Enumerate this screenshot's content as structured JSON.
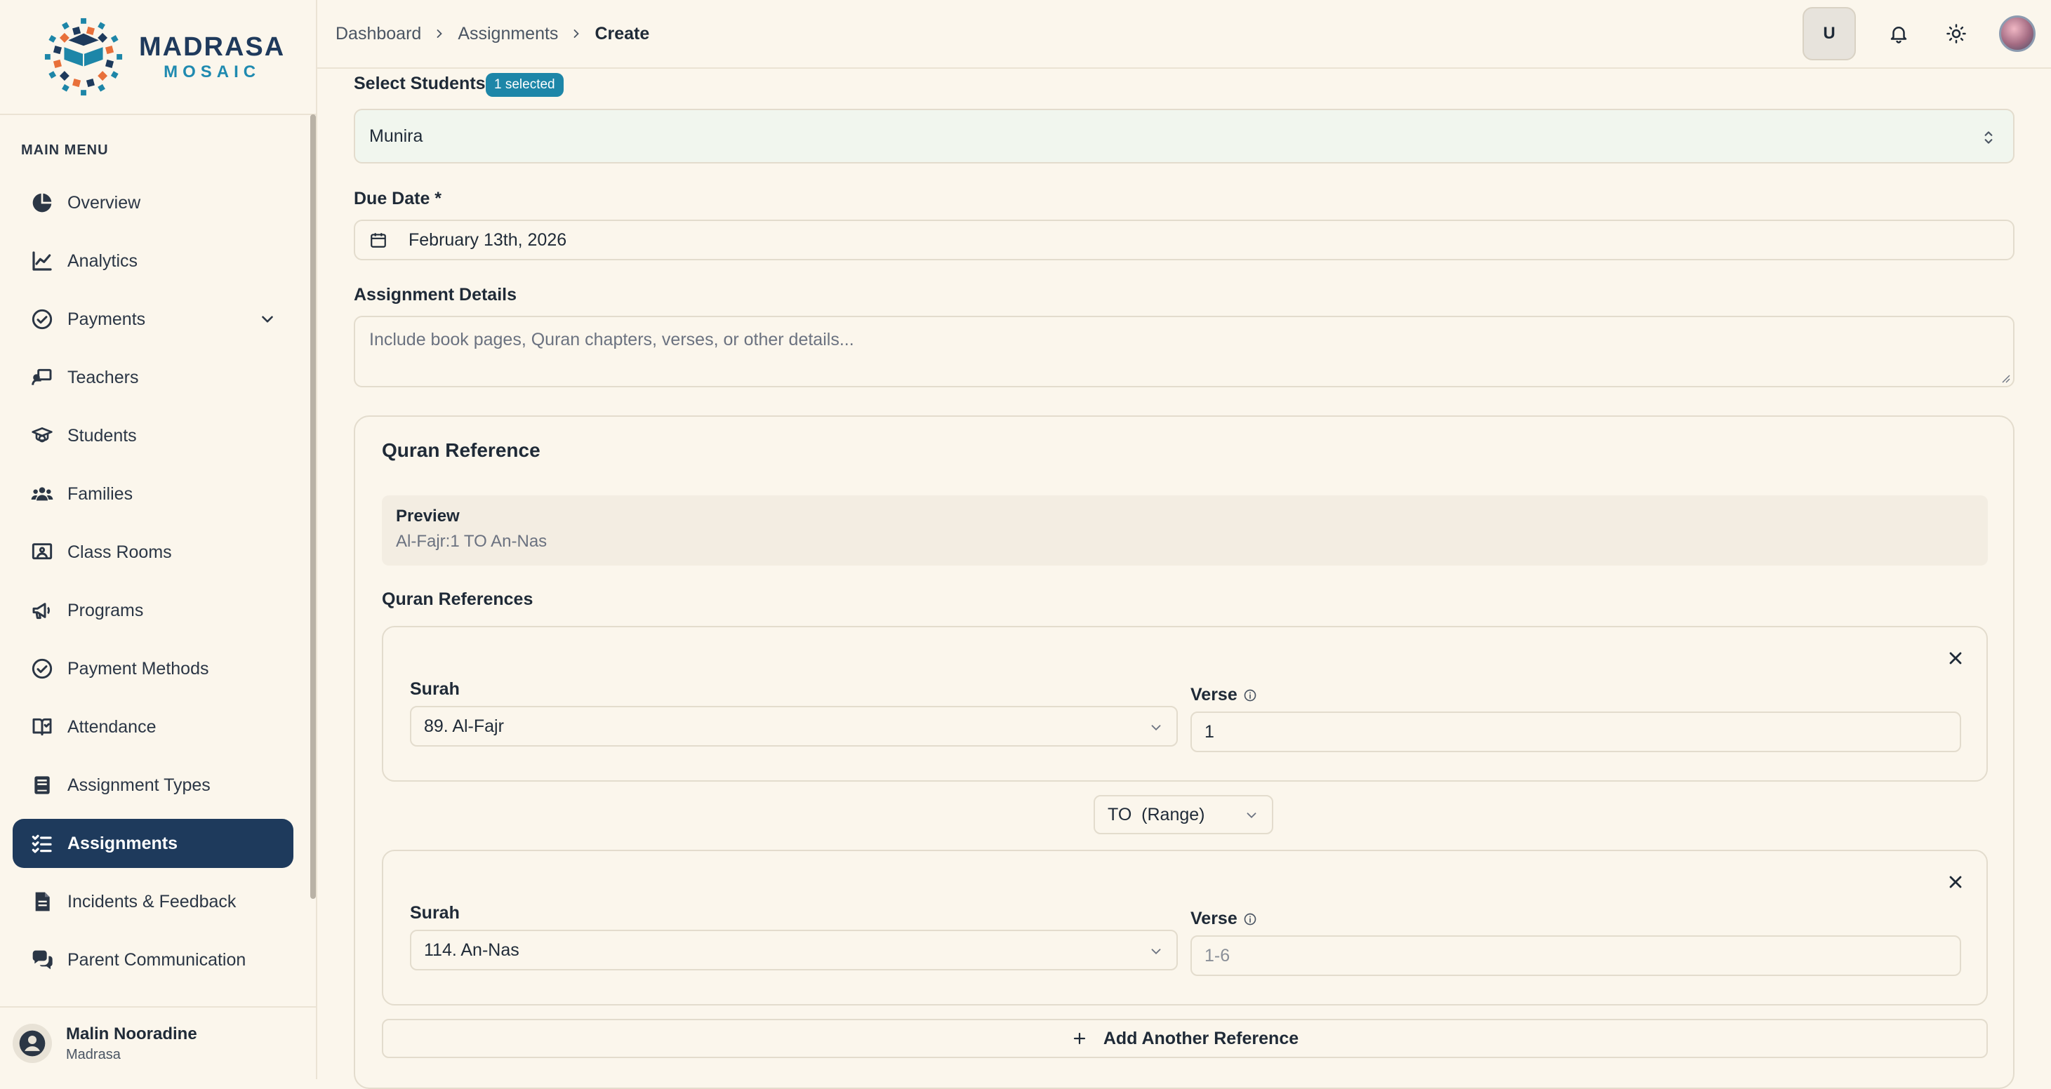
{
  "brand": {
    "title": "MADRASA",
    "subtitle": "MOSAIC",
    "colors": {
      "navy": "#1e3a5c",
      "teal": "#1d86a8",
      "orange": "#e8703a",
      "background": "#fbf6ec"
    }
  },
  "sidebar": {
    "menu_label": "MAIN MENU",
    "items": [
      {
        "label": "Overview",
        "icon": "pie-chart-icon"
      },
      {
        "label": "Analytics",
        "icon": "line-chart-icon"
      },
      {
        "label": "Payments",
        "icon": "check-circle-icon",
        "expandable": true
      },
      {
        "label": "Teachers",
        "icon": "teacher-board-icon"
      },
      {
        "label": "Students",
        "icon": "graduation-cap-icon"
      },
      {
        "label": "Families",
        "icon": "users-icon"
      },
      {
        "label": "Class Rooms",
        "icon": "classroom-icon"
      },
      {
        "label": "Programs",
        "icon": "megaphone-icon"
      },
      {
        "label": "Payment Methods",
        "icon": "check-circle-icon"
      },
      {
        "label": "Attendance",
        "icon": "book-check-icon"
      },
      {
        "label": "Assignment Types",
        "icon": "book-icon"
      },
      {
        "label": "Assignments",
        "icon": "list-check-icon",
        "active": true
      },
      {
        "label": "Incidents & Feedback",
        "icon": "file-text-icon"
      },
      {
        "label": "Parent Communication",
        "icon": "chat-bubbles-icon"
      }
    ],
    "user": {
      "name": "Malin Nooradine",
      "role": "Madrasa"
    }
  },
  "topbar": {
    "breadcrumbs": [
      "Dashboard",
      "Assignments",
      "Create"
    ],
    "user_initial": "U"
  },
  "form": {
    "students": {
      "label": "Select Students",
      "badge": "1 selected",
      "value": "Munira"
    },
    "due_date": {
      "label": "Due Date *",
      "value": "February 13th, 2026"
    },
    "details": {
      "label": "Assignment Details",
      "placeholder": "Include book pages, Quran chapters, verses, or other details..."
    },
    "quran": {
      "title": "Quran Reference",
      "preview_label": "Preview",
      "preview_value": "Al-Fajr:1 TO An-Nas",
      "refs_label": "Quran References",
      "references": [
        {
          "surah_label": "Surah",
          "surah": "89. Al-Fajr",
          "verse_label": "Verse",
          "verse": "1",
          "verse_placeholder": false
        },
        {
          "surah_label": "Surah",
          "surah": "114. An-Nas",
          "verse_label": "Verse",
          "verse": "1-6",
          "verse_placeholder": true
        }
      ],
      "range_selector": "TO  (Range)",
      "add_button": "Add Another Reference"
    }
  }
}
